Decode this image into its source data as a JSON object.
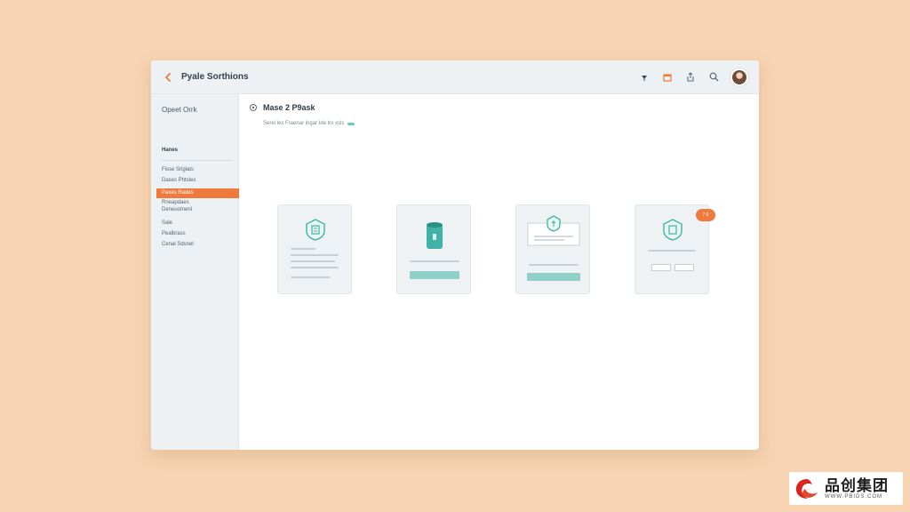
{
  "window": {
    "title": "Pyale Sorthions"
  },
  "sidebar": {
    "top_label": "Opeet Orrk",
    "heading": "Hanes",
    "items": [
      {
        "label": "Fisse Sriglats"
      },
      {
        "label": "Dases Phtsles"
      },
      {
        "label": "Paxes Rades",
        "active": true
      },
      {
        "label": "Rneapdaes",
        "sub": "Deneuomenl"
      },
      {
        "label": "Sale"
      },
      {
        "label": "Pealbrass"
      },
      {
        "label": "Cenal Sdsnel"
      }
    ]
  },
  "main": {
    "title": "Mase 2 P9ask",
    "subtitle": "Serel les Fraenar ingar Ide lro xsls"
  },
  "cards": [
    {
      "icon": "shield-document-icon"
    },
    {
      "icon": "teal-cylinder-icon",
      "button": true
    },
    {
      "icon": "upload-form-icon",
      "button": true
    },
    {
      "icon": "shield-form-icon",
      "badge": "7 0"
    }
  ],
  "colors": {
    "accent": "#ee7a3c",
    "teal": "#3fb3a5",
    "background": "#f7d3b1"
  },
  "watermark": {
    "brand_cn": "品创集团",
    "brand_url": "WWW.PBIDS.COM"
  }
}
